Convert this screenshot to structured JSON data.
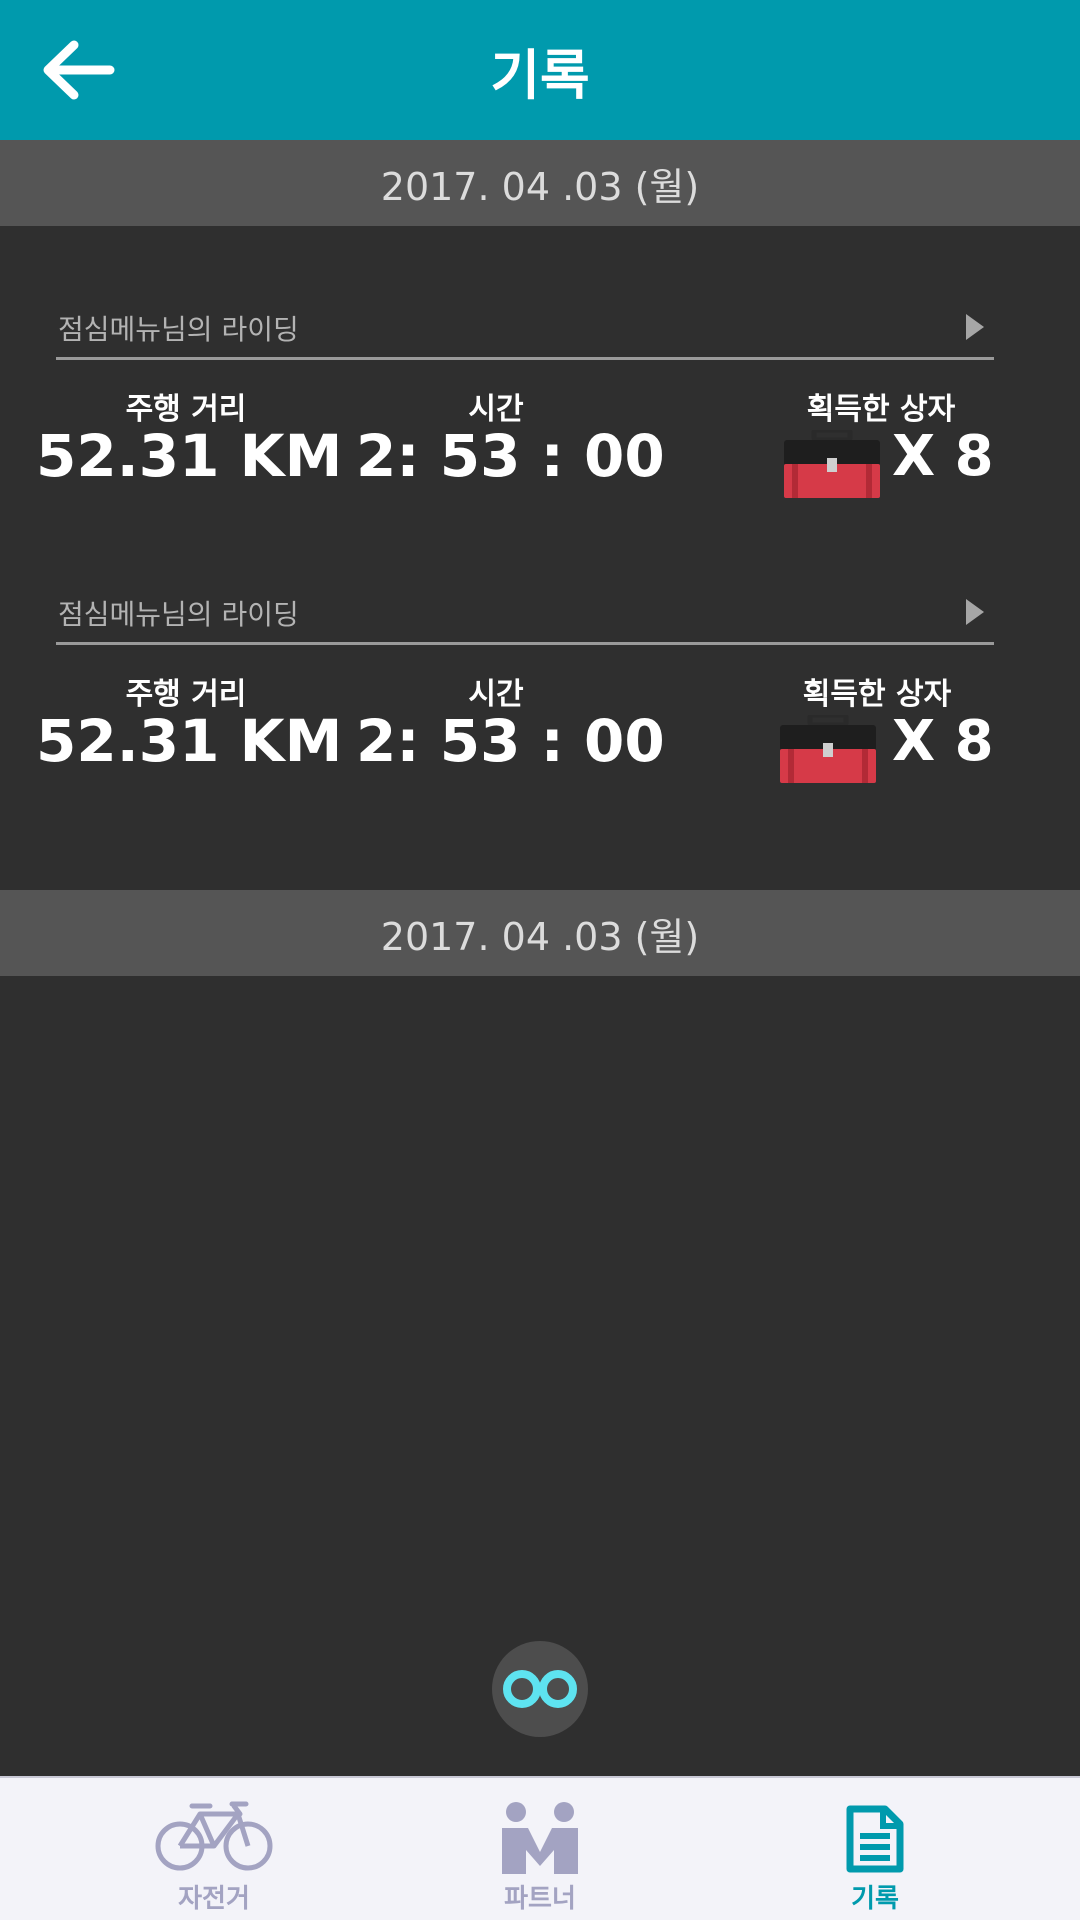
{
  "header": {
    "title": "기록"
  },
  "sections": [
    {
      "date": "2017. 04 .03 (월)"
    },
    {
      "date": "2017. 04 .03 (월)"
    }
  ],
  "records": [
    {
      "name": "점심메뉴님의 라이딩",
      "distance_label": "주행 거리",
      "distance_value": "52.31 KM",
      "time_label": "시간",
      "time_value": "2: 53 : 00",
      "boxes_label": "획득한 상자",
      "boxes_value": "X 8"
    },
    {
      "name": "점심메뉴님의 라이딩",
      "distance_label": "주행 거리",
      "distance_value": "52.31 KM",
      "time_label": "시간",
      "time_value": "2: 53 : 00",
      "boxes_label": "획득한 상자",
      "boxes_value": "X 8"
    }
  ],
  "bottom_nav": [
    {
      "label": "자전거",
      "icon": "bicycle-icon",
      "active": false
    },
    {
      "label": "파트너",
      "icon": "partner-icon",
      "active": false
    },
    {
      "label": "기록",
      "icon": "record-document-icon",
      "active": true
    }
  ],
  "colors": {
    "header_bg": "#009aad",
    "body_bg": "#2f2f2f",
    "date_bar_bg": "#555555",
    "nav_inactive": "#a3a3c2",
    "nav_active": "#009aad",
    "infinity_accent": "#5ee3f0",
    "toolbox_red": "#d63a48"
  }
}
